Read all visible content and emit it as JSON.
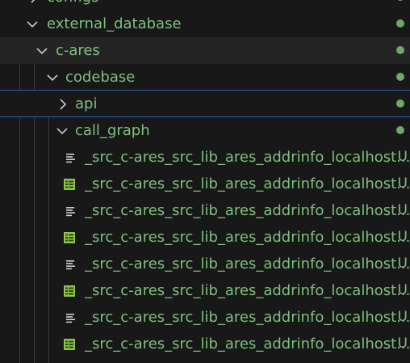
{
  "explorer": {
    "configs": {
      "label": "configs"
    },
    "external_database": {
      "label": "external_database"
    },
    "c_ares": {
      "label": "c-ares"
    },
    "codebase": {
      "label": "codebase"
    },
    "api": {
      "label": "api"
    },
    "call_graph": {
      "label": "call_graph"
    },
    "files": [
      {
        "name": "_src_c-ares_src_lib_ares_addrinfo_localhost...",
        "status": "U",
        "icon": "text-lines-icon"
      },
      {
        "name": "_src_c-ares_src_lib_ares_addrinfo_localhost...",
        "status": "U",
        "icon": "table-icon"
      },
      {
        "name": "_src_c-ares_src_lib_ares_addrinfo_localhost...",
        "status": "U",
        "icon": "text-lines-icon"
      },
      {
        "name": "_src_c-ares_src_lib_ares_addrinfo_localhost...",
        "status": "U",
        "icon": "table-icon"
      },
      {
        "name": "_src_c-ares_src_lib_ares_addrinfo_localhost...",
        "status": "U",
        "icon": "text-lines-icon"
      },
      {
        "name": "_src_c-ares_src_lib_ares_addrinfo_localhost...",
        "status": "U",
        "icon": "table-icon"
      },
      {
        "name": "_src_c-ares_src_lib_ares_addrinfo_localhost...",
        "status": "U",
        "icon": "text-lines-icon"
      },
      {
        "name": "_src_c-ares_src_lib_ares_addrinfo_localhost...",
        "status": "U",
        "icon": "table-icon"
      }
    ]
  },
  "colors": {
    "background": "#181818",
    "untracked_text": "#7ec07e",
    "selection_border": "#2a63a8"
  }
}
